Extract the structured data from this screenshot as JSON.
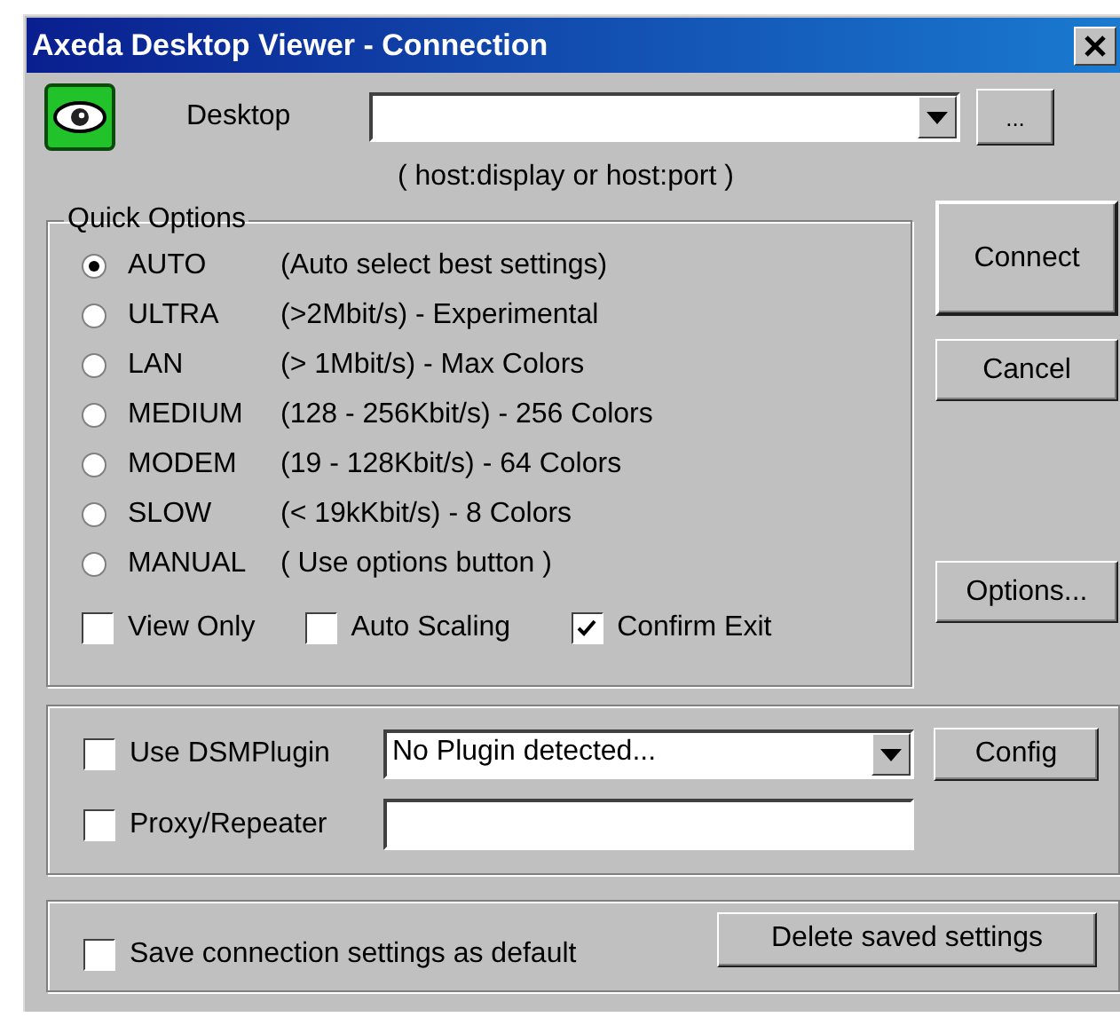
{
  "window": {
    "title": "Axeda Desktop Viewer - Connection"
  },
  "desktop": {
    "label": "Desktop",
    "browse_button": "...",
    "hint": "( host:display or host:port )"
  },
  "quick_options": {
    "title": "Quick Options",
    "modes": [
      {
        "label": "AUTO",
        "description": "(Auto select best settings)",
        "selected": true
      },
      {
        "label": "ULTRA",
        "description": "(>2Mbit/s) - Experimental",
        "selected": false
      },
      {
        "label": "LAN",
        "description": "(> 1Mbit/s) - Max Colors",
        "selected": false
      },
      {
        "label": "MEDIUM",
        "description": "(128 - 256Kbit/s) - 256 Colors",
        "selected": false
      },
      {
        "label": "MODEM",
        "description": "(19 - 128Kbit/s) - 64 Colors",
        "selected": false
      },
      {
        "label": "SLOW",
        "description": "(< 19kKbit/s) - 8 Colors",
        "selected": false
      },
      {
        "label": "MANUAL",
        "description": "( Use options button )",
        "selected": false
      }
    ],
    "checkboxes": [
      {
        "label": "View Only",
        "checked": false
      },
      {
        "label": "Auto Scaling",
        "checked": false
      },
      {
        "label": "Confirm Exit",
        "checked": true
      }
    ]
  },
  "side_buttons": [
    "Connect",
    "Cancel",
    "Options..."
  ],
  "plugin": {
    "use_dsm": {
      "label": "Use DSMPlugin",
      "checked": false
    },
    "plugin_value": "No Plugin detected...",
    "config_button": "Config",
    "proxy": {
      "label": "Proxy/Repeater",
      "checked": false
    }
  },
  "footer": {
    "save_default": {
      "label": "Save connection settings as default",
      "checked": false
    },
    "delete_button": "Delete saved settings"
  }
}
